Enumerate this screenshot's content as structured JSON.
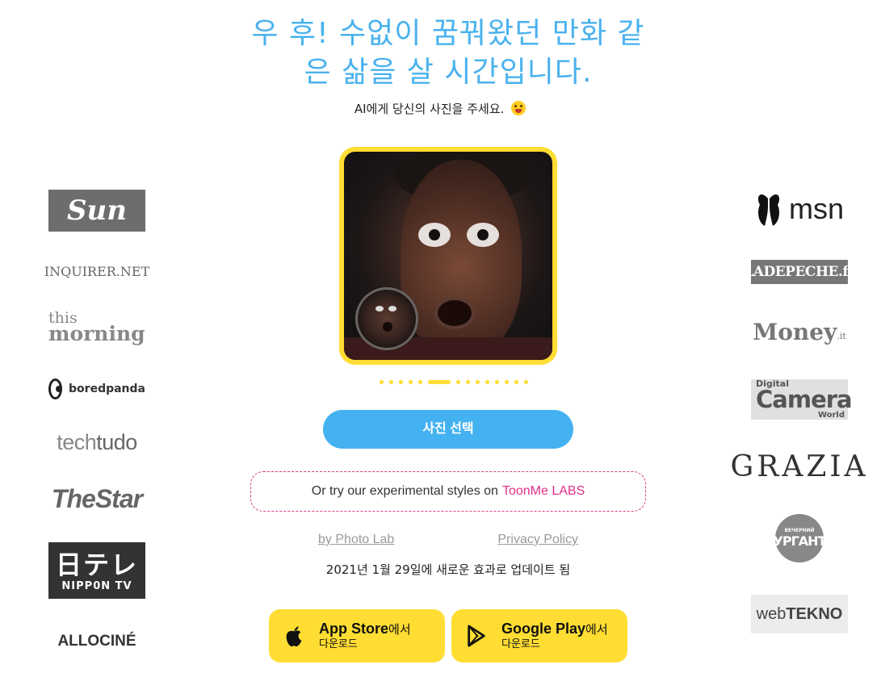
{
  "hero": {
    "title_line1": "우 후! 수없이 꿈꿔왔던 만화 같",
    "title_line2": "은 삶을 살 시간입니다.",
    "subtitle": "AI에게 당신의 사진을 주세요."
  },
  "press_left": {
    "sun": "Sun",
    "inquirer": "INQUIRER.NET",
    "this_morning_1": "this",
    "this_morning_2": "morning",
    "boredpanda": "boredpanda",
    "techtudo_1": "tech",
    "techtudo_2": "tudo",
    "thestar": "TheStar",
    "nippon_1": "日テレ",
    "nippon_2": "NIPP0N TV",
    "allocine": "ALLOCINÉ"
  },
  "press_right": {
    "msn": "msn",
    "ladepeche": "LADEPECHE.fr",
    "money": "Money",
    "money_suffix": ".it",
    "camera_1": "Digital",
    "camera_2": "Camera",
    "camera_3": "World",
    "grazia": "GRAZIA",
    "urgant_1": "ВЕЧЕРНИЙ",
    "urgant_2": "УРГАНТ",
    "webtekno_1": "web",
    "webtekno_2": "TEKNO"
  },
  "carousel": {
    "dots": 14,
    "active_index": 5
  },
  "actions": {
    "select_photo": "사진 선택",
    "labs_text": "Or try our experimental styles on",
    "labs_link": "ToonMe LABS",
    "by_photolab": "by Photo Lab",
    "privacy": "Privacy Policy",
    "updated": "2021년 1월 29일에 새로운 효과로 업데이트 됨"
  },
  "stores": {
    "apple_name": "App Store",
    "apple_suffix": "에서",
    "apple_sub": "다운로드",
    "google_name": "Google Play",
    "google_suffix": "에서",
    "google_sub": "다운로드"
  },
  "colors": {
    "accent_blue": "#44b2f0",
    "accent_yellow": "#ffdd33",
    "labs_pink": "#e0308a"
  }
}
